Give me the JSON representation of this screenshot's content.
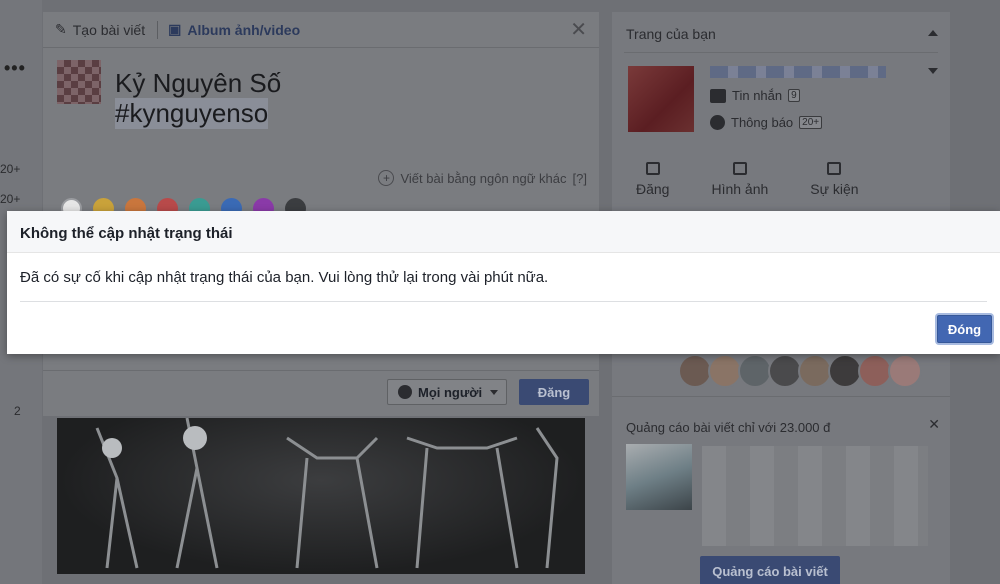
{
  "composer": {
    "tab_create": "Tạo bài viết",
    "tab_album": "Album ảnh/video",
    "text_line1": "Kỷ Nguyên Số",
    "text_line2": "#kynguyenso",
    "lang_label": "Viết bài bằng ngôn ngữ khác",
    "lang_help": "[?]",
    "swatch_colors": [
      "#e6e6e6",
      "#c9a23a",
      "#c9763d",
      "#b84a4a",
      "#3a9b92",
      "#3a6ab5",
      "#8a3aa8",
      "#3b3d40"
    ],
    "audience_label": "Mọi người",
    "post_label": "Đăng"
  },
  "left_rail": {
    "badge1": "20+",
    "badge2": "20+",
    "count3": "2"
  },
  "right_panel": {
    "title": "Trang của bạn",
    "messages_label": "Tin nhắn",
    "messages_count": "9",
    "notifications_label": "Thông báo",
    "notifications_count": "20+",
    "action_post": "Đăng",
    "action_photo": "Hình ảnh",
    "action_event": "Sự kiện",
    "ad_title": "Quảng cáo bài viết chỉ với 23.000 đ",
    "ad_button": "Quảng cáo bài viết"
  },
  "dialog": {
    "title": "Không thể cập nhật trạng thái",
    "message": "Đã có sự cố khi cập nhật trạng thái của bạn. Vui lòng thử lại trong vài phút nữa.",
    "close_label": "Đóng",
    "accent": "#4267b2"
  }
}
